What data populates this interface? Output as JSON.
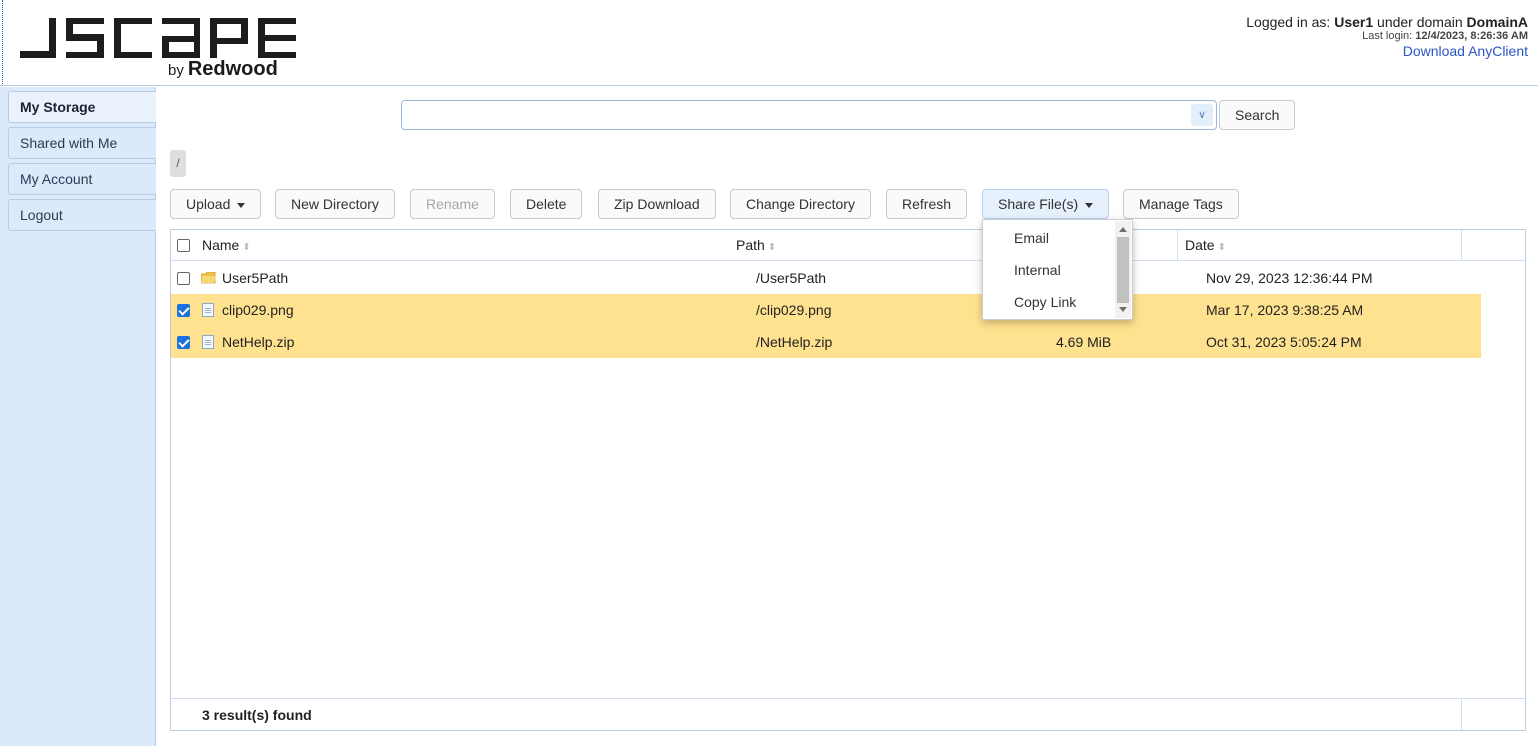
{
  "header": {
    "logo_text": "JSCAPE",
    "logo_by": "by",
    "logo_company": "Redwood",
    "logged_in_prefix": "Logged in as: ",
    "user": "User1",
    "domain_prefix": " under domain ",
    "domain": "DomainA",
    "last_login_label": "Last login: ",
    "last_login": "12/4/2023, 8:26:36 AM",
    "download_link": "Download AnyClient"
  },
  "sidebar": {
    "items": [
      {
        "label": "My Storage",
        "active": true
      },
      {
        "label": "Shared with Me"
      },
      {
        "label": "My Account"
      },
      {
        "label": "Logout"
      }
    ]
  },
  "search": {
    "value": "",
    "button": "Search"
  },
  "breadcrumb": "/",
  "toolbar": {
    "upload": "Upload",
    "new_directory": "New Directory",
    "rename": "Rename",
    "delete": "Delete",
    "zip_download": "Zip Download",
    "change_directory": "Change Directory",
    "refresh": "Refresh",
    "share_files": "Share File(s)",
    "manage_tags": "Manage Tags"
  },
  "share_menu": {
    "items": [
      "Email",
      "Internal",
      "Copy Link"
    ]
  },
  "table": {
    "columns": [
      "Name",
      "Path",
      "Date"
    ],
    "rows": [
      {
        "name": "User5Path",
        "path": "/User5Path",
        "size": "",
        "date": "Nov 29, 2023 12:36:44 PM",
        "type": "folder",
        "checked": false
      },
      {
        "name": "clip029.png",
        "path": "/clip029.png",
        "size": "",
        "date": "Mar 17, 2023 9:38:25 AM",
        "type": "file",
        "checked": true
      },
      {
        "name": "NetHelp.zip",
        "path": "/NetHelp.zip",
        "size": "4.69 MiB",
        "date": "Oct 31, 2023 5:05:24 PM",
        "type": "file",
        "checked": true
      }
    ],
    "footer": "3 result(s) found"
  },
  "colors": {
    "selected_row": "#ffe28f",
    "sidebar_bg": "#dbe9fa",
    "link": "#2a56c6",
    "checkbox_checked": "#1b6fe0"
  }
}
